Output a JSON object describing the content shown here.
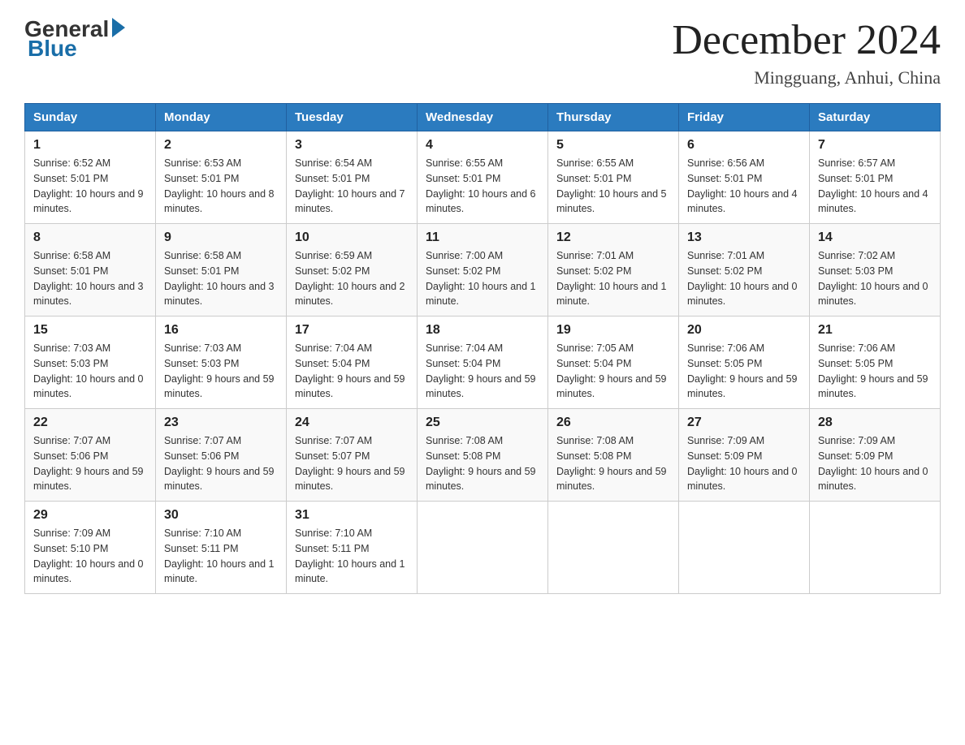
{
  "header": {
    "logo_general": "General",
    "logo_blue": "Blue",
    "month_title": "December 2024",
    "location": "Mingguang, Anhui, China"
  },
  "days_of_week": [
    "Sunday",
    "Monday",
    "Tuesday",
    "Wednesday",
    "Thursday",
    "Friday",
    "Saturday"
  ],
  "weeks": [
    [
      {
        "day": "1",
        "sunrise": "6:52 AM",
        "sunset": "5:01 PM",
        "daylight": "10 hours and 9 minutes."
      },
      {
        "day": "2",
        "sunrise": "6:53 AM",
        "sunset": "5:01 PM",
        "daylight": "10 hours and 8 minutes."
      },
      {
        "day": "3",
        "sunrise": "6:54 AM",
        "sunset": "5:01 PM",
        "daylight": "10 hours and 7 minutes."
      },
      {
        "day": "4",
        "sunrise": "6:55 AM",
        "sunset": "5:01 PM",
        "daylight": "10 hours and 6 minutes."
      },
      {
        "day": "5",
        "sunrise": "6:55 AM",
        "sunset": "5:01 PM",
        "daylight": "10 hours and 5 minutes."
      },
      {
        "day": "6",
        "sunrise": "6:56 AM",
        "sunset": "5:01 PM",
        "daylight": "10 hours and 4 minutes."
      },
      {
        "day": "7",
        "sunrise": "6:57 AM",
        "sunset": "5:01 PM",
        "daylight": "10 hours and 4 minutes."
      }
    ],
    [
      {
        "day": "8",
        "sunrise": "6:58 AM",
        "sunset": "5:01 PM",
        "daylight": "10 hours and 3 minutes."
      },
      {
        "day": "9",
        "sunrise": "6:58 AM",
        "sunset": "5:01 PM",
        "daylight": "10 hours and 3 minutes."
      },
      {
        "day": "10",
        "sunrise": "6:59 AM",
        "sunset": "5:02 PM",
        "daylight": "10 hours and 2 minutes."
      },
      {
        "day": "11",
        "sunrise": "7:00 AM",
        "sunset": "5:02 PM",
        "daylight": "10 hours and 1 minute."
      },
      {
        "day": "12",
        "sunrise": "7:01 AM",
        "sunset": "5:02 PM",
        "daylight": "10 hours and 1 minute."
      },
      {
        "day": "13",
        "sunrise": "7:01 AM",
        "sunset": "5:02 PM",
        "daylight": "10 hours and 0 minutes."
      },
      {
        "day": "14",
        "sunrise": "7:02 AM",
        "sunset": "5:03 PM",
        "daylight": "10 hours and 0 minutes."
      }
    ],
    [
      {
        "day": "15",
        "sunrise": "7:03 AM",
        "sunset": "5:03 PM",
        "daylight": "10 hours and 0 minutes."
      },
      {
        "day": "16",
        "sunrise": "7:03 AM",
        "sunset": "5:03 PM",
        "daylight": "9 hours and 59 minutes."
      },
      {
        "day": "17",
        "sunrise": "7:04 AM",
        "sunset": "5:04 PM",
        "daylight": "9 hours and 59 minutes."
      },
      {
        "day": "18",
        "sunrise": "7:04 AM",
        "sunset": "5:04 PM",
        "daylight": "9 hours and 59 minutes."
      },
      {
        "day": "19",
        "sunrise": "7:05 AM",
        "sunset": "5:04 PM",
        "daylight": "9 hours and 59 minutes."
      },
      {
        "day": "20",
        "sunrise": "7:06 AM",
        "sunset": "5:05 PM",
        "daylight": "9 hours and 59 minutes."
      },
      {
        "day": "21",
        "sunrise": "7:06 AM",
        "sunset": "5:05 PM",
        "daylight": "9 hours and 59 minutes."
      }
    ],
    [
      {
        "day": "22",
        "sunrise": "7:07 AM",
        "sunset": "5:06 PM",
        "daylight": "9 hours and 59 minutes."
      },
      {
        "day": "23",
        "sunrise": "7:07 AM",
        "sunset": "5:06 PM",
        "daylight": "9 hours and 59 minutes."
      },
      {
        "day": "24",
        "sunrise": "7:07 AM",
        "sunset": "5:07 PM",
        "daylight": "9 hours and 59 minutes."
      },
      {
        "day": "25",
        "sunrise": "7:08 AM",
        "sunset": "5:08 PM",
        "daylight": "9 hours and 59 minutes."
      },
      {
        "day": "26",
        "sunrise": "7:08 AM",
        "sunset": "5:08 PM",
        "daylight": "9 hours and 59 minutes."
      },
      {
        "day": "27",
        "sunrise": "7:09 AM",
        "sunset": "5:09 PM",
        "daylight": "10 hours and 0 minutes."
      },
      {
        "day": "28",
        "sunrise": "7:09 AM",
        "sunset": "5:09 PM",
        "daylight": "10 hours and 0 minutes."
      }
    ],
    [
      {
        "day": "29",
        "sunrise": "7:09 AM",
        "sunset": "5:10 PM",
        "daylight": "10 hours and 0 minutes."
      },
      {
        "day": "30",
        "sunrise": "7:10 AM",
        "sunset": "5:11 PM",
        "daylight": "10 hours and 1 minute."
      },
      {
        "day": "31",
        "sunrise": "7:10 AM",
        "sunset": "5:11 PM",
        "daylight": "10 hours and 1 minute."
      },
      null,
      null,
      null,
      null
    ]
  ],
  "labels": {
    "sunrise": "Sunrise:",
    "sunset": "Sunset:",
    "daylight": "Daylight:"
  }
}
